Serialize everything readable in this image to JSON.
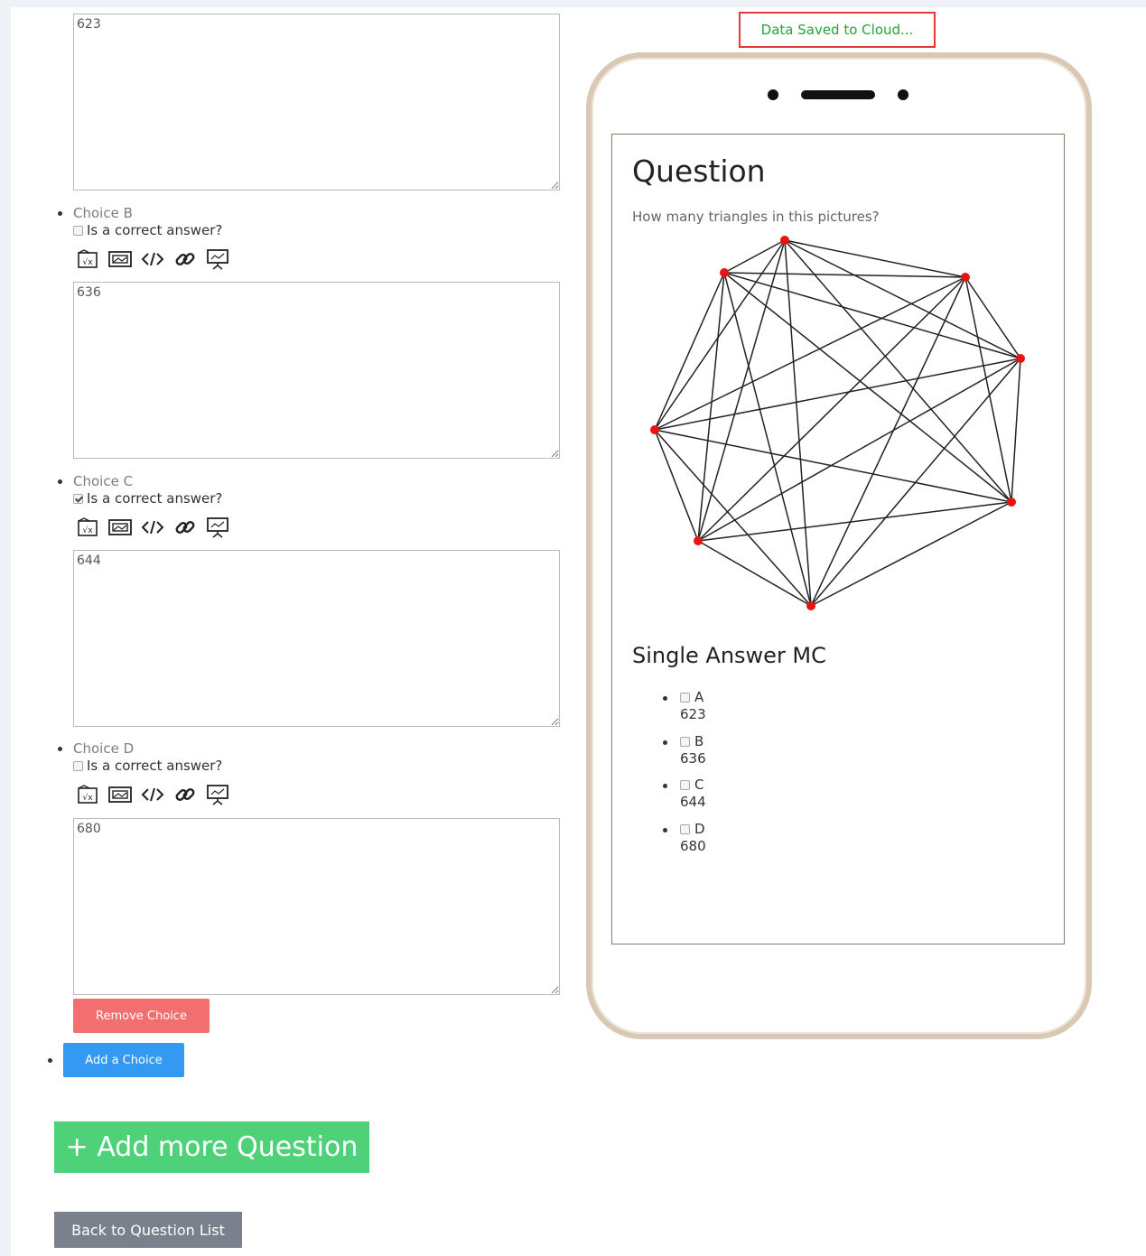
{
  "status": "Data Saved to Cloud...",
  "editor": {
    "correct_label": "Is a correct answer?",
    "choices": [
      {
        "label": "",
        "value": "623",
        "correct": false
      },
      {
        "label": "Choice B",
        "value": "636",
        "correct": false
      },
      {
        "label": "Choice C",
        "value": "644",
        "correct": true
      },
      {
        "label": "Choice D",
        "value": "680",
        "correct": false
      }
    ],
    "toolbar_icons": [
      "formula-icon",
      "image-icon",
      "code-icon",
      "link-icon",
      "presentation-icon"
    ],
    "remove_choice": "Remove Choice",
    "add_choice": "Add a Choice",
    "add_question": "+ Add more Question",
    "back": "Back to Question List"
  },
  "preview": {
    "title": "Question",
    "question_text": "How many triangles in this pictures?",
    "mc_title": "Single Answer MC",
    "options": [
      {
        "letter": "A",
        "value": "623"
      },
      {
        "letter": "B",
        "value": "636"
      },
      {
        "letter": "C",
        "value": "644"
      },
      {
        "letter": "D",
        "value": "680"
      }
    ]
  },
  "colors": {
    "status_border": "#e03a3a",
    "status_text": "#27a23a",
    "remove_button": "#f26f6f",
    "add_choice_button": "#3399f3",
    "add_question_button": "#4fd17a",
    "back_button": "#7a808c",
    "graph_node": "#e8140f"
  }
}
